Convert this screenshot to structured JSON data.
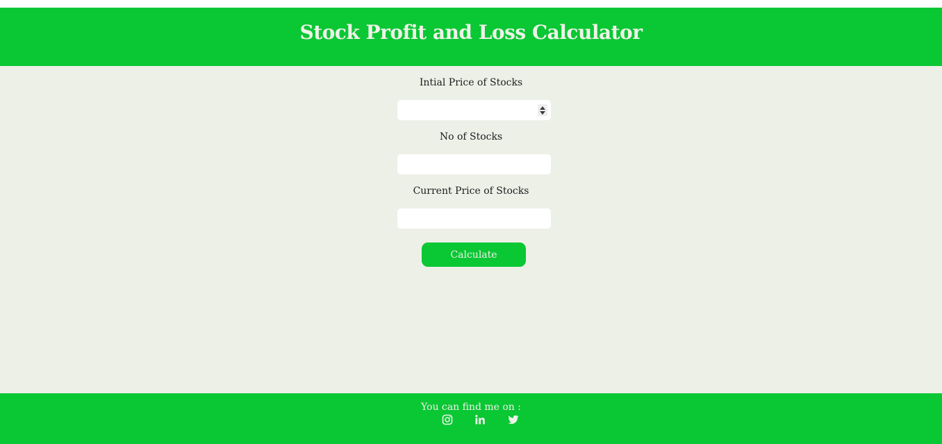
{
  "header": {
    "title": "Stock Profit and Loss Calculator"
  },
  "form": {
    "initial_price_label": "Intial Price of Stocks",
    "initial_price_value": "",
    "quantity_label": "No of Stocks",
    "quantity_value": "",
    "current_price_label": "Current Price of Stocks",
    "current_price_value": "",
    "calculate_label": "Calculate"
  },
  "footer": {
    "text": "You can find me on :",
    "links": [
      {
        "icon": "instagram-icon"
      },
      {
        "icon": "linkedin-icon"
      },
      {
        "icon": "twitter-icon"
      }
    ]
  },
  "colors": {
    "brand_green": "#0ac734",
    "background": "#edf0e7",
    "header_text": "#eef2e7"
  }
}
